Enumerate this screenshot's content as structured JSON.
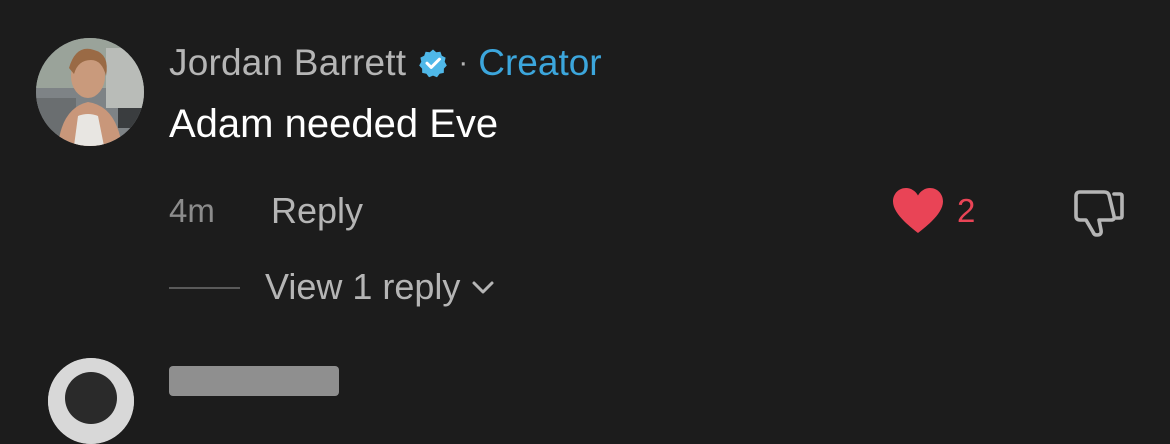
{
  "comment": {
    "author": "Jordan Barrett",
    "separator": "·",
    "role_badge": "Creator",
    "text": "Adam needed Eve",
    "timestamp": "4m",
    "reply_label": "Reply",
    "like_count": "2",
    "liked": true,
    "view_replies_label": "View 1 reply"
  },
  "colors": {
    "background": "#1c1c1c",
    "author": "#b5b5b5",
    "creator": "#3ca6dc",
    "like": "#e94456",
    "verified": "#4fb8e8"
  },
  "icons": {
    "verified": "verified-check-icon",
    "like": "heart-icon",
    "dislike": "thumbs-down-icon",
    "expand": "chevron-down-icon"
  }
}
